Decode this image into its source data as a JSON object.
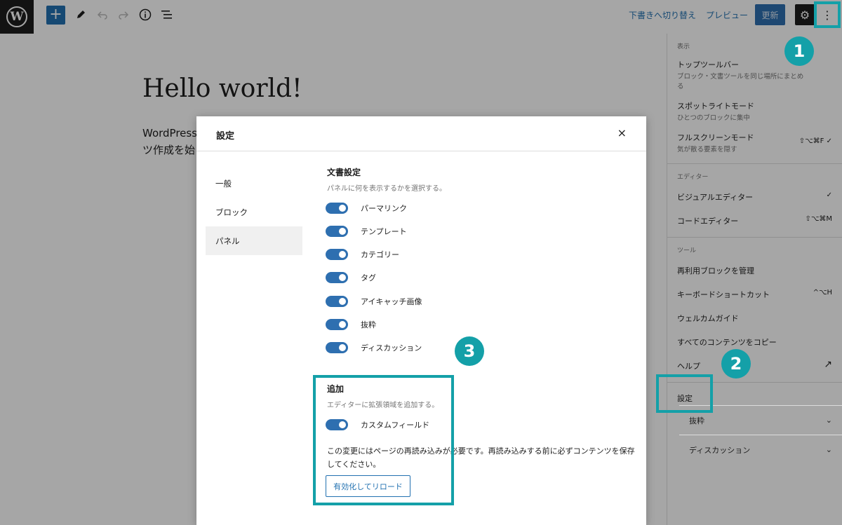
{
  "toolbar": {
    "logo": "W",
    "add": "+",
    "switch_to_draft": "下書きへ切り替え",
    "preview": "プレビュー",
    "update": "更新"
  },
  "post": {
    "title": "Hello world!",
    "body_line1": "WordPress",
    "body_line2": "ツ作成を始"
  },
  "modal": {
    "title": "設定",
    "close": "×",
    "nav": [
      "一般",
      "ブロック",
      "パネル"
    ],
    "doc_settings": {
      "title": "文書設定",
      "desc": "パネルに何を表示するかを選択する。",
      "toggles": [
        "パーマリンク",
        "テンプレート",
        "カテゴリー",
        "タグ",
        "アイキャッチ画像",
        "抜粋",
        "ディスカッション"
      ]
    },
    "additional": {
      "title": "追加",
      "desc": "エディターに拡張領域を追加する。",
      "toggle": "カスタムフィールド",
      "notice": "この変更にはページの再読み込みが必要です。再読み込みする前に必ずコンテンツを保存してください。",
      "button": "有効化してリロード"
    }
  },
  "menu": {
    "view": {
      "heading": "表示",
      "items": [
        {
          "label": "トップツールバー",
          "desc": "ブロック・文書ツールを同じ場所にまとめる",
          "right": ""
        },
        {
          "label": "スポットライトモード",
          "desc": "ひとつのブロックに集中",
          "right": ""
        },
        {
          "label": "フルスクリーンモード",
          "desc": "気が散る要素を隠す",
          "right": "⇧⌥⌘F ✓"
        }
      ]
    },
    "editor": {
      "heading": "エディター",
      "items": [
        {
          "label": "ビジュアルエディター",
          "right": "✓"
        },
        {
          "label": "コードエディター",
          "right": "⇧⌥⌘M"
        }
      ]
    },
    "tools": {
      "heading": "ツール",
      "items": [
        {
          "label": "再利用ブロックを管理",
          "right": ""
        },
        {
          "label": "キーボードショートカット",
          "right": "^⌥H"
        },
        {
          "label": "ウェルカムガイド",
          "right": ""
        },
        {
          "label": "すべてのコンテンツをコピー",
          "right": ""
        },
        {
          "label": "ヘルプ",
          "right": "↗"
        }
      ]
    },
    "settings": "設定"
  },
  "sidebar_panels": [
    "抜粋",
    "ディスカッション"
  ],
  "annotations": {
    "step1": "1",
    "step2": "2",
    "step3": "3"
  },
  "colors": {
    "accent": "#2271b1",
    "highlight": "#14a0a8"
  }
}
